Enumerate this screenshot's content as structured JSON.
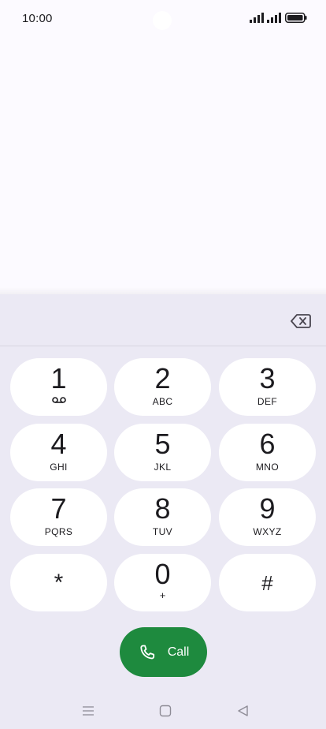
{
  "status_bar": {
    "time": "10:00",
    "icons": [
      "signal-icon",
      "signal-icon",
      "battery-icon"
    ]
  },
  "dialer": {
    "backspace_icon": "backspace-icon",
    "keys": [
      {
        "digit": "1",
        "sub": "",
        "sub_icon": "voicemail-icon"
      },
      {
        "digit": "2",
        "sub": "ABC"
      },
      {
        "digit": "3",
        "sub": "DEF"
      },
      {
        "digit": "4",
        "sub": "GHI"
      },
      {
        "digit": "5",
        "sub": "JKL"
      },
      {
        "digit": "6",
        "sub": "MNO"
      },
      {
        "digit": "7",
        "sub": "PQRS"
      },
      {
        "digit": "8",
        "sub": "TUV"
      },
      {
        "digit": "9",
        "sub": "WXYZ"
      },
      {
        "digit": "*",
        "sub": ""
      },
      {
        "digit": "0",
        "sub": "+"
      },
      {
        "digit": "#",
        "sub": ""
      }
    ],
    "call_label": "Call",
    "call_icon": "phone-icon",
    "colors": {
      "call_button": "#1e8a3e",
      "panel": "#ebe9f4",
      "key": "#ffffff"
    }
  },
  "nav_bar": {
    "icons": [
      "menu-icon",
      "home-icon",
      "back-icon"
    ]
  }
}
